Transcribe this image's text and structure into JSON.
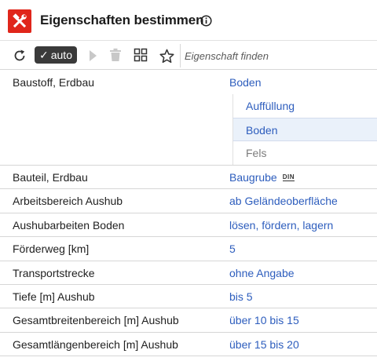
{
  "header": {
    "title": "Eigenschaften bestimmen",
    "logo_icon": "hammer-wrench-icon",
    "info_icon": "info-icon",
    "brand_color": "#e0261b"
  },
  "toolbar": {
    "refresh_icon": "refresh-icon",
    "auto_label": "auto",
    "play_icon": "play-icon",
    "trash_icon": "trash-icon",
    "grid_icon": "grid-icon",
    "star_icon": "star-icon",
    "search_placeholder": "Eigenschaft finden"
  },
  "properties": [
    {
      "label": "Baustoff, Erdbau",
      "value": "Boden",
      "options": [
        {
          "label": "Auffüllung",
          "state": "link"
        },
        {
          "label": "Boden",
          "state": "selected"
        },
        {
          "label": "Fels",
          "state": "disabled"
        }
      ]
    },
    {
      "label": "Bauteil, Erdbau",
      "value": "Baugrube",
      "badge": "DIN"
    },
    {
      "label": "Arbeitsbereich Aushub",
      "value": "ab Geländeoberfläche"
    },
    {
      "label": "Aushubarbeiten Boden",
      "value": "lösen, fördern, lagern"
    },
    {
      "label": "Förderweg [km]",
      "value": "5"
    },
    {
      "label": "Transportstrecke",
      "value": "ohne Angabe"
    },
    {
      "label": "Tiefe [m] Aushub",
      "value": "bis 5"
    },
    {
      "label": "Gesamtbreitenbereich [m] Aushub",
      "value": "über 10 bis 15"
    },
    {
      "label": "Gesamtlängenbereich [m] Aushub",
      "value": "über 15 bis 20"
    }
  ],
  "colors": {
    "link": "#2d5dbd",
    "selected_bg": "#eaf1fa"
  }
}
